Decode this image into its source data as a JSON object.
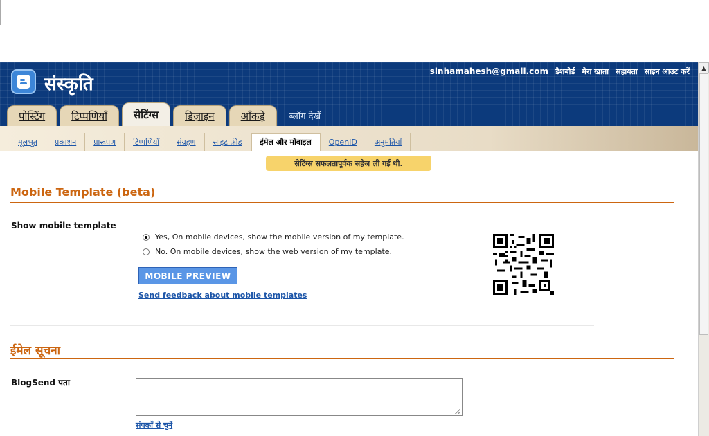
{
  "header": {
    "blog_title": "संस्कृति",
    "email": "sinhamahesh@gmail.com",
    "links": [
      "डैशबोर्ड",
      "मेरा खाता",
      "सहायता",
      "साइन आउट करें"
    ]
  },
  "tabs": [
    {
      "label": "पोस्टिंग"
    },
    {
      "label": "टिप्पणियाँ"
    },
    {
      "label": "सेटिंग्स"
    },
    {
      "label": "डिज़ाइन"
    },
    {
      "label": "आँकड़े"
    },
    {
      "label": "ब्लॉग देखें"
    }
  ],
  "subnav": [
    "मूलभूत",
    "प्रकाशन",
    "प्रारूपण",
    "टिप्पणियाँ",
    "संग्रहण",
    "साइट फ़ीड",
    "ईमेल और मोबाइल",
    "OpenID",
    "अनुमतियाँ"
  ],
  "notice": "सेटिंग्स सफलतापूर्वक सहेज ली गई थी.",
  "mobile": {
    "title": "Mobile Template (beta)",
    "label": "Show mobile template",
    "option_yes": "Yes, On mobile devices, show the mobile version of my template.",
    "option_no": "No. On mobile devices, show the web version of my template.",
    "selected": "yes",
    "preview_button": "MOBILE PREVIEW",
    "feedback_link": "Send feedback about mobile templates"
  },
  "email": {
    "title": "ईमेल सूचना",
    "blogsend_label": "BlogSend पता",
    "blogsend_value": "",
    "contacts_link": "संपर्कों से चुनें"
  },
  "colors": {
    "header_bg": "#0c3a7c",
    "section_title": "#cc6611",
    "link": "#1c55a8",
    "notice_bg": "#f7d36b",
    "button_bg": "#5a96e6"
  },
  "icons": [
    "blogger-logo-icon",
    "qr-code-icon",
    "scroll-up-arrow-icon"
  ]
}
